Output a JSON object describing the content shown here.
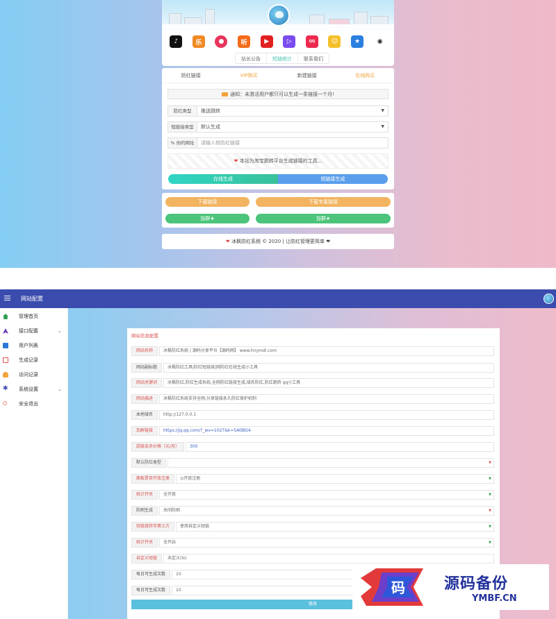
{
  "top": {
    "hero_tabs": [
      "站长公告",
      "短链统计",
      "联系我们"
    ],
    "nav": [
      "防红链接",
      "VIP购买",
      "新建链接",
      "在线购买"
    ],
    "notice": "通知：未激活用户都只可以生成一条链接一个月!",
    "form": [
      {
        "label": "防红类型",
        "value": "推送跳转",
        "select": true
      },
      {
        "label": "短链接类型",
        "value": "默认生成",
        "select": true
      },
      {
        "label": "% 你的网址",
        "value": "请输入转防红链接",
        "placeholder": true
      }
    ],
    "stripe_text": "本站为淘宝跳转平台生成链接的工具...",
    "generate_btn": "在线生成",
    "short_btn": "短链接生成",
    "btn_row1": [
      "下载链接",
      "下载专属链接"
    ],
    "btn_row2": [
      "加群★",
      "加群★"
    ],
    "footer": "冰枫防红系统 © 2020 | 让防红管理更简单 ❤"
  },
  "admin": {
    "title": "网站配置",
    "sidebar": [
      {
        "label": "管理首页",
        "icon": "home-icon",
        "color": "#2e9e4f"
      },
      {
        "label": "接口配置",
        "icon": "navigation-icon",
        "color": "#6a3ab5",
        "chevron": true
      },
      {
        "label": "用户列表",
        "icon": "book-icon",
        "color": "#2b78d4"
      },
      {
        "label": "生成记录",
        "icon": "list-icon",
        "color": "#d9534f"
      },
      {
        "label": "访问记录",
        "icon": "bell-icon",
        "color": "#f0a33d"
      },
      {
        "label": "系统设置",
        "icon": "gear-icon",
        "color": "#3b4cae",
        "chevron": true
      },
      {
        "label": "安全退出",
        "icon": "power-icon",
        "color": "#e04a2c"
      }
    ],
    "panel_title": "网站信息配置",
    "rows": [
      {
        "label": "网站名称",
        "value": "冰枫防红系统 | 源码分享平台【源码网】 www.hnymdl.com",
        "red": true
      },
      {
        "label": "网站副标题",
        "value": "冰枫防红工具|防红短链接|网防红在线生成小工具",
        "red": false
      },
      {
        "label": "网站关键词",
        "value": "冰枫防红,防红生成系统,全网防红链接生成,域名防红,防红跳转 qq小工具",
        "red": true
      },
      {
        "label": "网站描述",
        "value": "冰枫防红系统支持全网,分享链接永久防红保护机制",
        "red": true
      },
      {
        "label": "本地域名",
        "value": "http://127.0.0.1",
        "red": false
      },
      {
        "label": "加群链接",
        "value": "https://jq.qq.com/?_wv=1027&k=5AtlBG4",
        "red": true,
        "blue": true
      },
      {
        "label": "超级会员价格（元/月）",
        "value": "300",
        "red": true,
        "blue": true
      },
      {
        "label": "默认防红类型",
        "value": "",
        "red": false,
        "select": true
      },
      {
        "label": "面板是否开放注册",
        "value": "◎开放注册",
        "red": true,
        "select": true
      },
      {
        "label": "统计开关",
        "value": "全开放",
        "red": true,
        "select": true
      },
      {
        "label": "防刷生成",
        "value": "关闭防刷",
        "red": false,
        "select": true
      },
      {
        "label": "短链接转存第三方",
        "value": "使用自定义短链",
        "red": true,
        "select": true
      },
      {
        "label": "统计开关",
        "value": "全开启",
        "red": true,
        "select": true
      },
      {
        "label": "自定义短链",
        "value": "未定义(ls)",
        "red": true
      },
      {
        "label": "每日可生成次数",
        "value": "10",
        "red": false
      },
      {
        "label": "每日可生成次数",
        "value": "10",
        "red": false
      }
    ],
    "submit": "修改"
  },
  "watermark": {
    "text1": "源码备份",
    "text2": "YMBF.CN",
    "glyph": "码"
  },
  "colors": {
    "primary": "#3b4cae",
    "teal": "#39c19a",
    "blue": "#5a9eec",
    "orange": "#f2b461",
    "green": "#4cc47b"
  }
}
